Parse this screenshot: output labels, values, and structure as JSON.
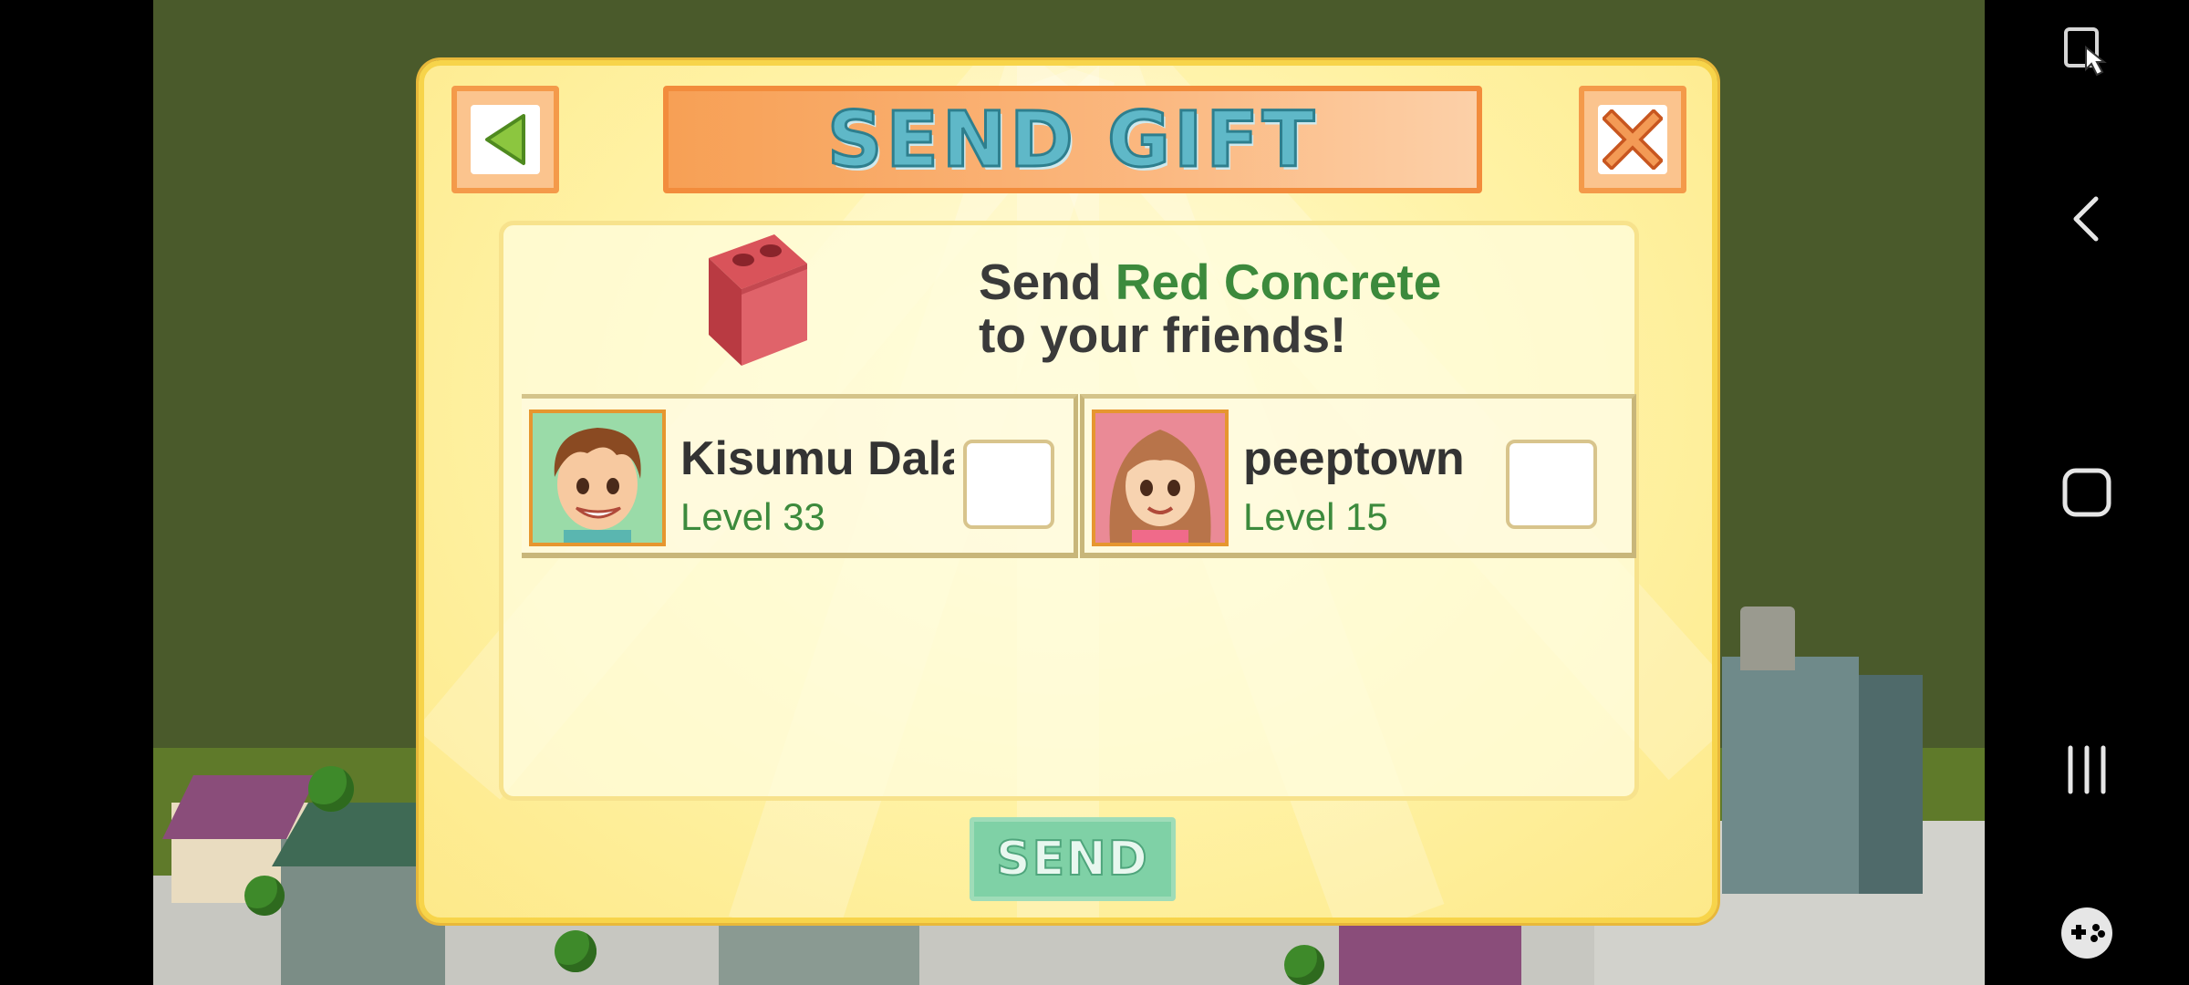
{
  "dialog": {
    "title": "SEND GIFT",
    "gift_prefix": "Send ",
    "gift_item": "Red Concrete",
    "gift_suffix": "to your friends!",
    "send_label": "SEND"
  },
  "friends": [
    {
      "name": "Kisumu Dala",
      "level": "Level 33",
      "checked": false
    },
    {
      "name": "peeptown",
      "level": "Level 15",
      "checked": false
    }
  ],
  "icons": {
    "back": "back-arrow-icon",
    "close": "close-icon",
    "gift": "red-concrete-block-icon",
    "nav_top": "screen-touch-icon",
    "nav_back": "chevron-left-icon",
    "nav_home": "home-square-icon",
    "nav_recents": "recents-bars-icon",
    "nav_game": "gamepad-icon"
  },
  "colors": {
    "dialog_border": "#f7d44a",
    "title_text": "#5fb8c8",
    "accent_green": "#3c8a3c",
    "send_button": "#7fd1a6",
    "orange_button": "#f49a4a"
  }
}
